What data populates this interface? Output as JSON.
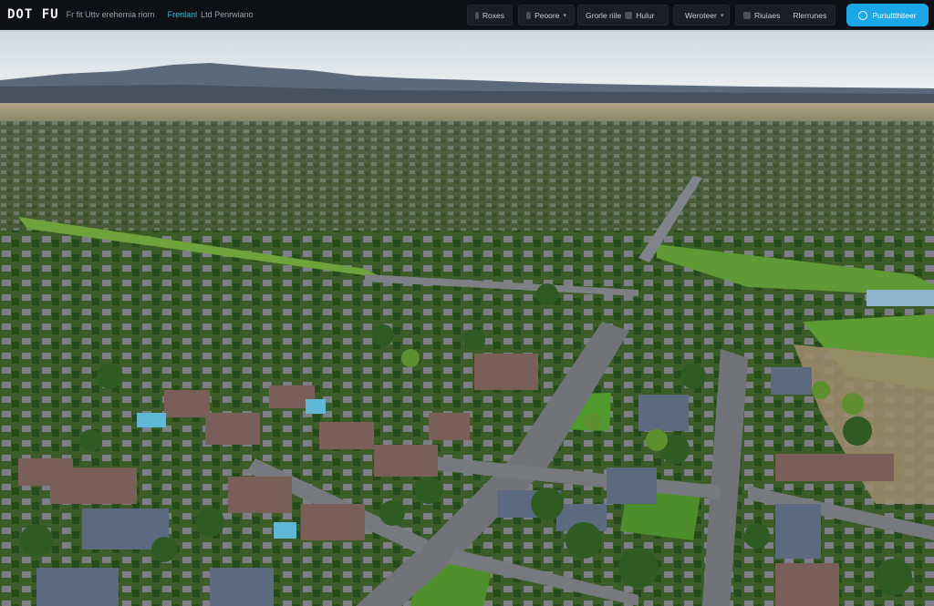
{
  "topbar": {
    "brand": "DOT FU",
    "brand_subtitle": "Fr fit Uttv erehemia riorn",
    "brand_tag": "Frenlanl",
    "brand_tag_2": "Ltd Penrwiano",
    "nav": [
      {
        "label": "Roxes",
        "icon": "grid-icon"
      },
      {
        "label": "Peoore",
        "icon": "people-icon",
        "has_dropdown": true
      },
      {
        "label": "Grorle riile",
        "icon": "map-icon"
      },
      {
        "label": "Hulur",
        "icon": "chart-icon"
      },
      {
        "label": "Weroteer",
        "icon": "weather-icon",
        "has_dropdown": true
      },
      {
        "label": "Riuiaes",
        "icon": "layers-icon"
      },
      {
        "label": "Rlerrunes",
        "icon": "settings-icon"
      }
    ],
    "cta_label": "Puriuttthiteer",
    "cta_icon": "globe-icon"
  },
  "scene": {
    "description_icon": "aerial-photo",
    "colors": {
      "sky_top": "#cfd9e3",
      "sky_bottom": "#e8ecef",
      "mountains": "#5b6a7b",
      "grass": "#4f8f2c",
      "road": "#6f7378",
      "tree": "#2f5a22"
    }
  }
}
